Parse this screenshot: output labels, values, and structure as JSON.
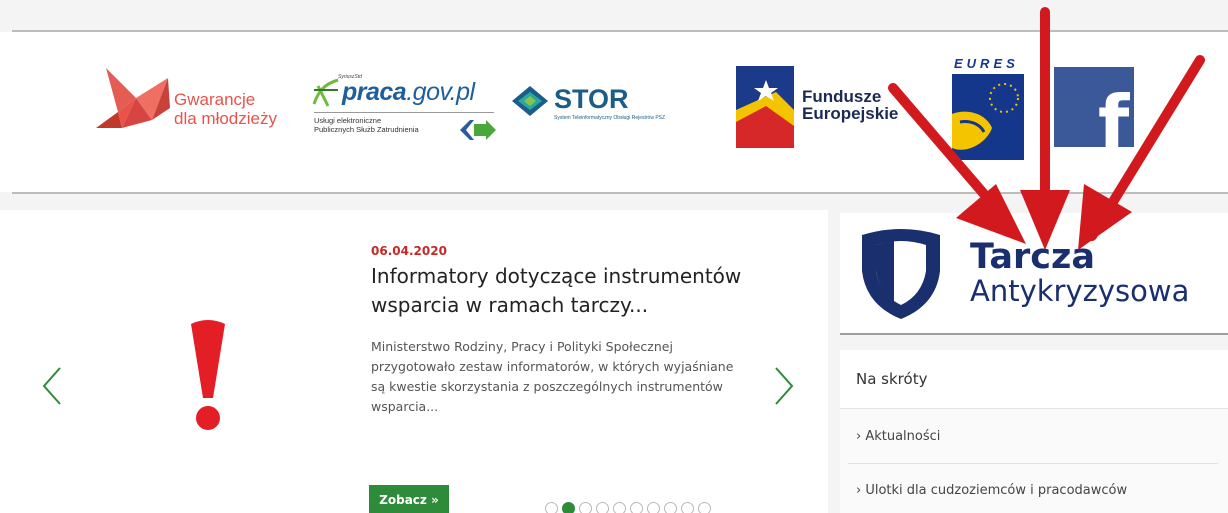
{
  "logos": {
    "gwarancje": {
      "line1": "Gwarancje",
      "line2": "dla młodzieży"
    },
    "praca": {
      "small": "SyriuszStd",
      "main": "praca",
      "domain": ".gov.pl",
      "sub1": "Usługi elektroniczne",
      "sub2": "Publicznych Służb Zatrudnienia"
    },
    "stor": {
      "name": "STOR",
      "sub": "System Teleinformatyczny Obsługi Rejestrów PSZ"
    },
    "fundusze": {
      "line1": "Fundusze",
      "line2": "Europejskie"
    },
    "eures": {
      "name": "EURES"
    },
    "facebook": {
      "letter": "f"
    }
  },
  "slider": {
    "date": "06.04.2020",
    "title": "Informatory dotyczące instrumentów wsparcia w ramach tarczy...",
    "excerpt": "Ministerstwo Rodziny, Pracy i Polityki Społecznej przygotowało zestaw informatorów, w których wyjaśniane są kwestie skorzystania z poszczególnych instrumentów wsparcia...",
    "button": "Zobacz »",
    "prev_icon": "chevron-left-icon",
    "next_icon": "chevron-right-icon",
    "dots_total": 10,
    "active_dot": 2
  },
  "tarcza": {
    "line1": "Tarcza",
    "line2": "Antykryzysowa"
  },
  "shortcuts": {
    "title": "Na skróty",
    "items": [
      {
        "label": "› Aktualności"
      },
      {
        "label": "› Ulotki dla cudzoziemców i pracodawców"
      }
    ]
  },
  "colors": {
    "green": "#2e8b3a",
    "red_date": "#c62828",
    "navy": "#1a2f6e",
    "annotation_red": "#d2191e"
  }
}
